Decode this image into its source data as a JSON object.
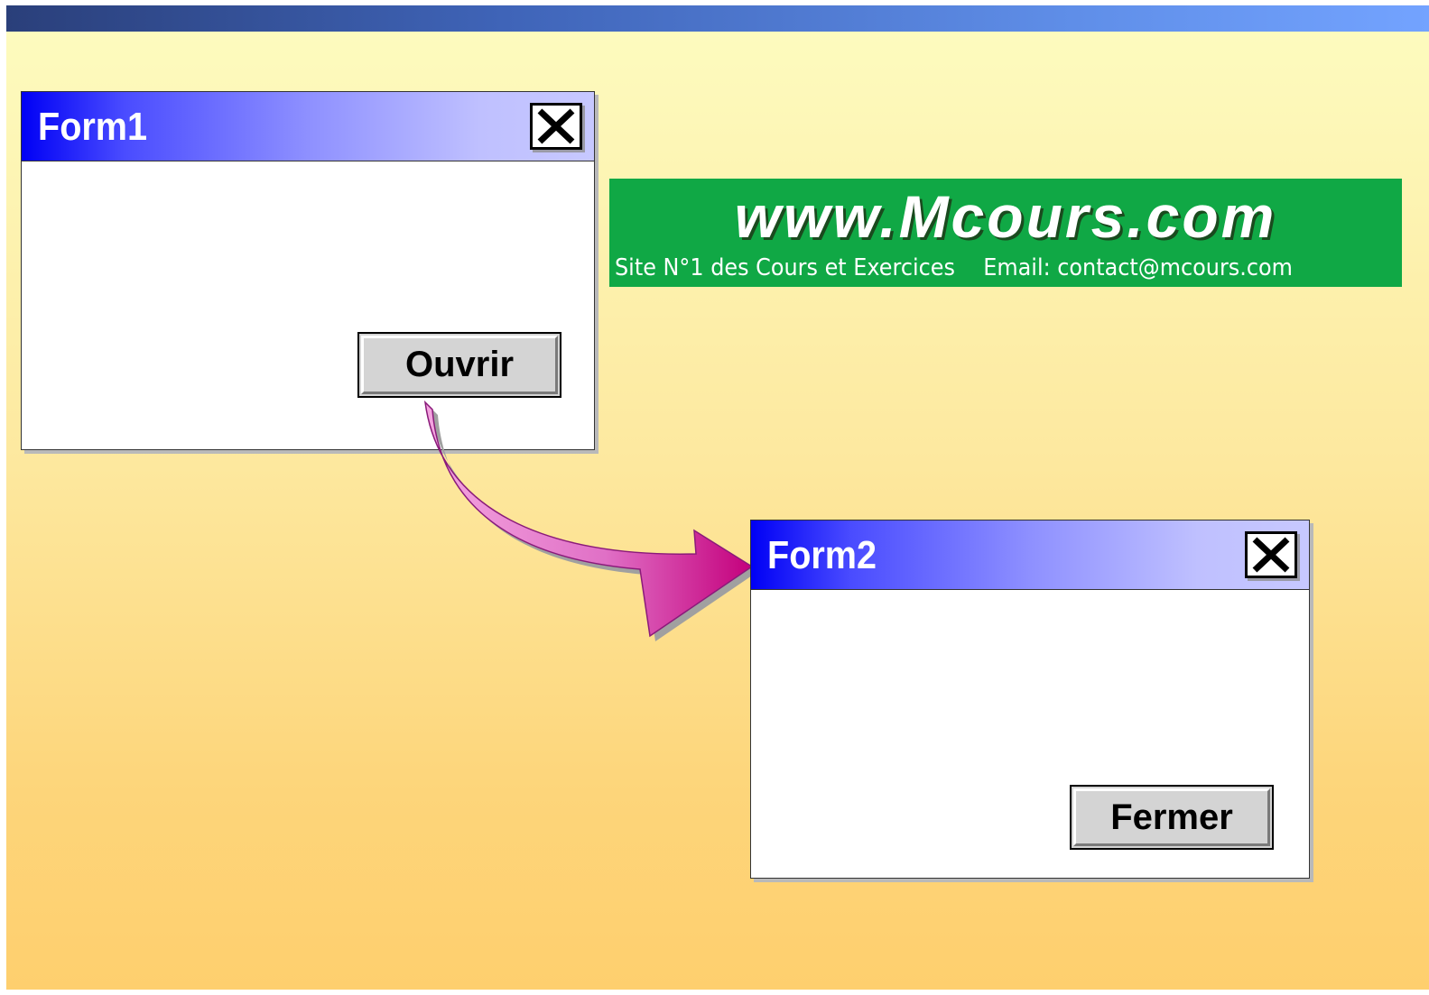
{
  "banner": {
    "title": "www.Mcours.com",
    "tagline": "Site N°1 des Cours et Exercices",
    "email": "Email: contact@mcours.com"
  },
  "form1": {
    "title": "Form1",
    "button_label": "Ouvrir",
    "close_icon": "close-icon"
  },
  "form2": {
    "title": "Form2",
    "button_label": "Fermer",
    "close_icon": "close-icon"
  },
  "colors": {
    "titlebar_start": "#0000f5",
    "titlebar_end": "#c7c8ff",
    "arrow": "#e060c0",
    "banner_bg": "#10a845"
  }
}
